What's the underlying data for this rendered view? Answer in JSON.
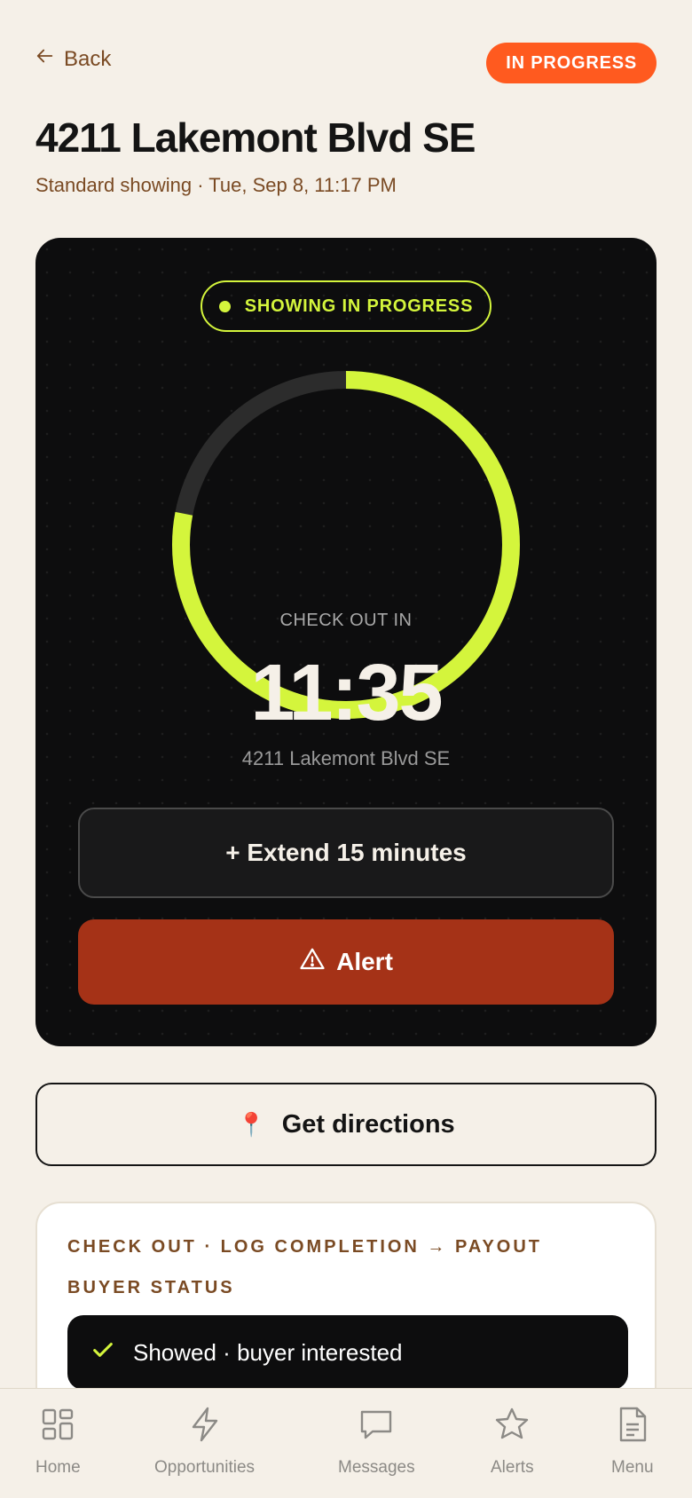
{
  "header": {
    "back_label": "Back",
    "status": "IN PROGRESS",
    "title": "4211 Lakemont Blvd SE",
    "subtitle": "Standard showing · Tue, Sep 8, 11:17 PM"
  },
  "session": {
    "status_label": "SHOWING IN PROGRESS",
    "countdown_label": "CHECK OUT IN",
    "countdown_value": "11:35",
    "progress_remaining_fraction": 0.78,
    "address": "4211 Lakemont Blvd SE",
    "extend_label": "+ Extend 15 minutes",
    "alert_label": "Alert"
  },
  "directions": {
    "label": "Get directions",
    "icon": "📍"
  },
  "completion": {
    "kicker": "CHECK OUT · LOG COMPLETION → PAYOUT",
    "buyer_status_label": "BUYER STATUS",
    "selected_option": "Showed · buyer interested"
  },
  "tabs": [
    {
      "label": "Home",
      "icon": "grid-icon"
    },
    {
      "label": "Opportunities",
      "icon": "bolt-icon"
    },
    {
      "label": "Messages",
      "icon": "message-icon"
    },
    {
      "label": "Alerts",
      "icon": "star-icon"
    },
    {
      "label": "Menu",
      "icon": "document-icon"
    }
  ],
  "colors": {
    "accent": "#ff5a1f",
    "lime": "#d4f53c",
    "alert": "#a53217",
    "background": "#f5f0e8",
    "brown_text": "#7a4a23"
  }
}
